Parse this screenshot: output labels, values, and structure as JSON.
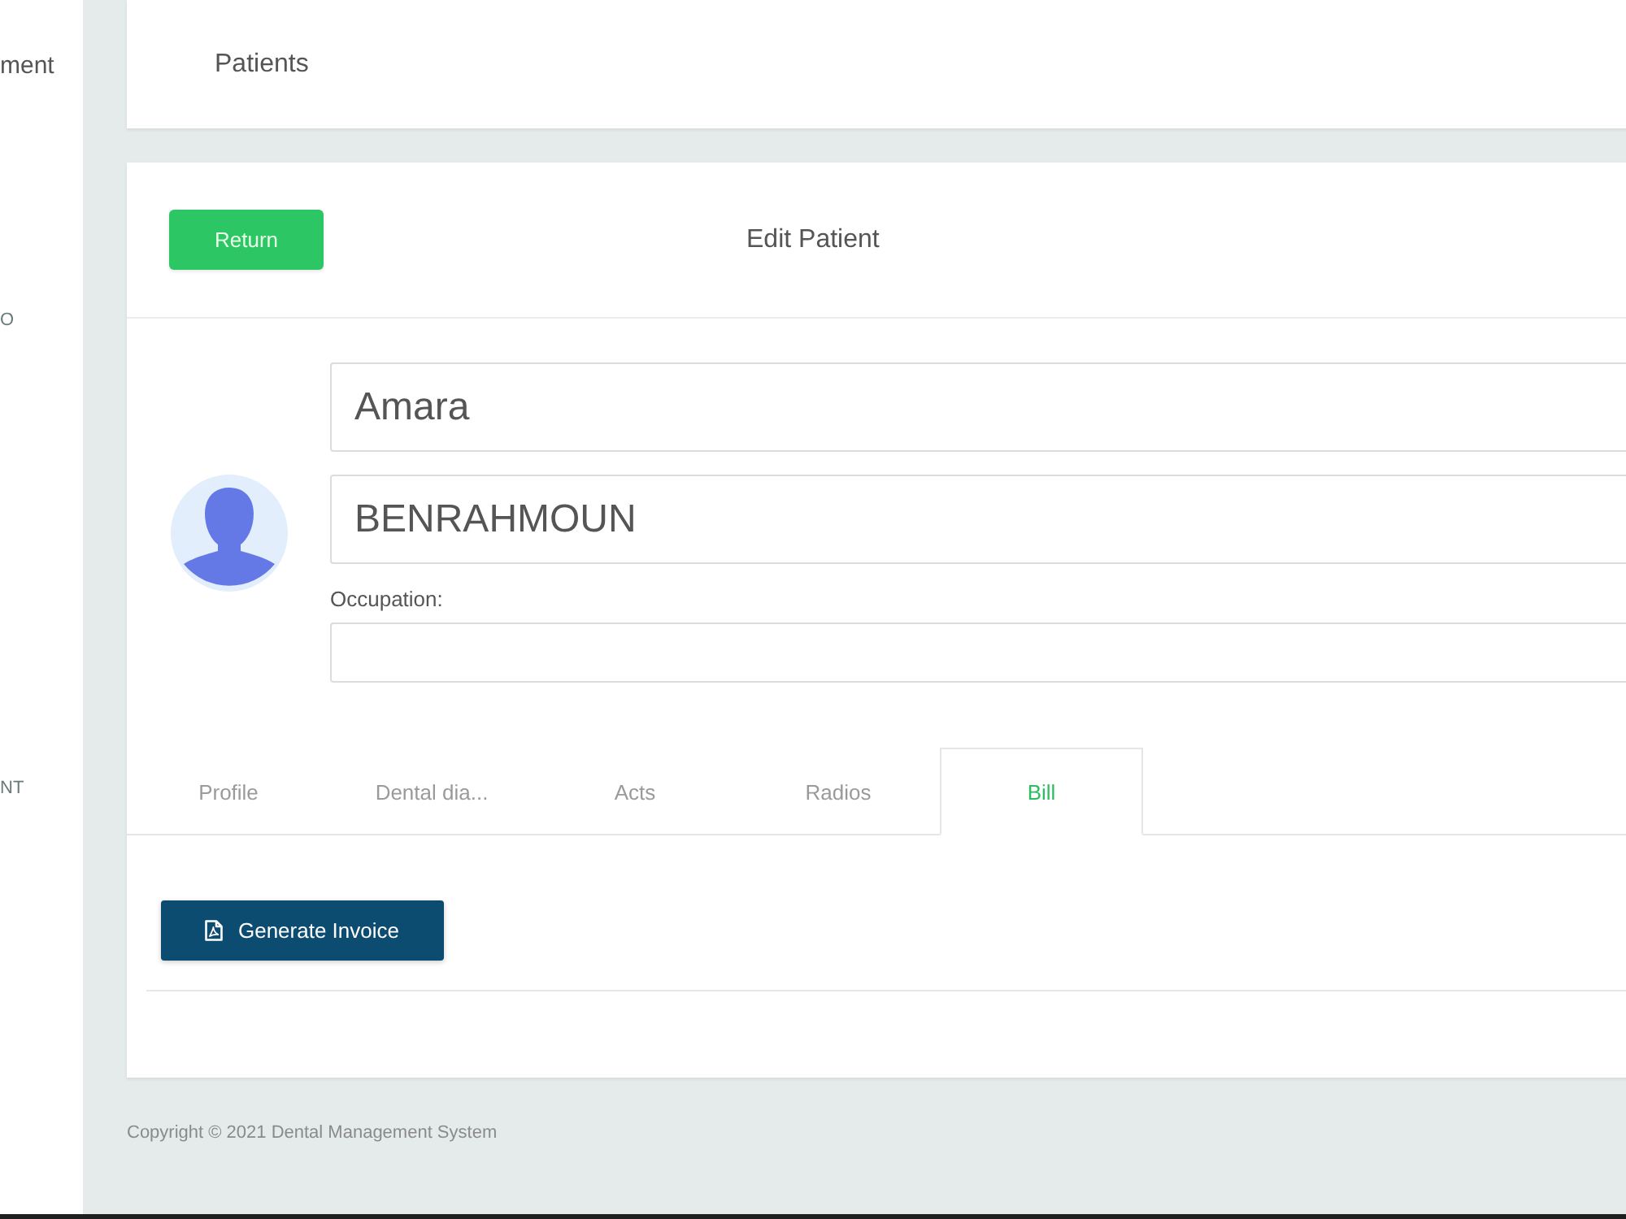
{
  "sidebar": {
    "items": [
      {
        "label": "ment",
        "kind": "brand"
      },
      {
        "label": "O",
        "kind": "nav"
      },
      {
        "label": "NT",
        "kind": "nav"
      }
    ]
  },
  "header": {
    "title": "Patients"
  },
  "edit_card": {
    "return_button": "Return",
    "title": "Edit Patient",
    "first_name": {
      "value": "Amara"
    },
    "last_name": {
      "value": "BENRAHMOUN"
    },
    "occupation": {
      "label": "Occupation:"
    }
  },
  "tabs": [
    {
      "label": "Profile",
      "selected": false
    },
    {
      "label": "Dental dia...",
      "selected": false
    },
    {
      "label": "Acts",
      "selected": false
    },
    {
      "label": "Radios",
      "selected": false
    },
    {
      "label": "Bill",
      "selected": true
    }
  ],
  "bill": {
    "generate_button": "Generate Invoice"
  },
  "footer": {
    "copyright": "Copyright © 2021 Dental Management System"
  }
}
